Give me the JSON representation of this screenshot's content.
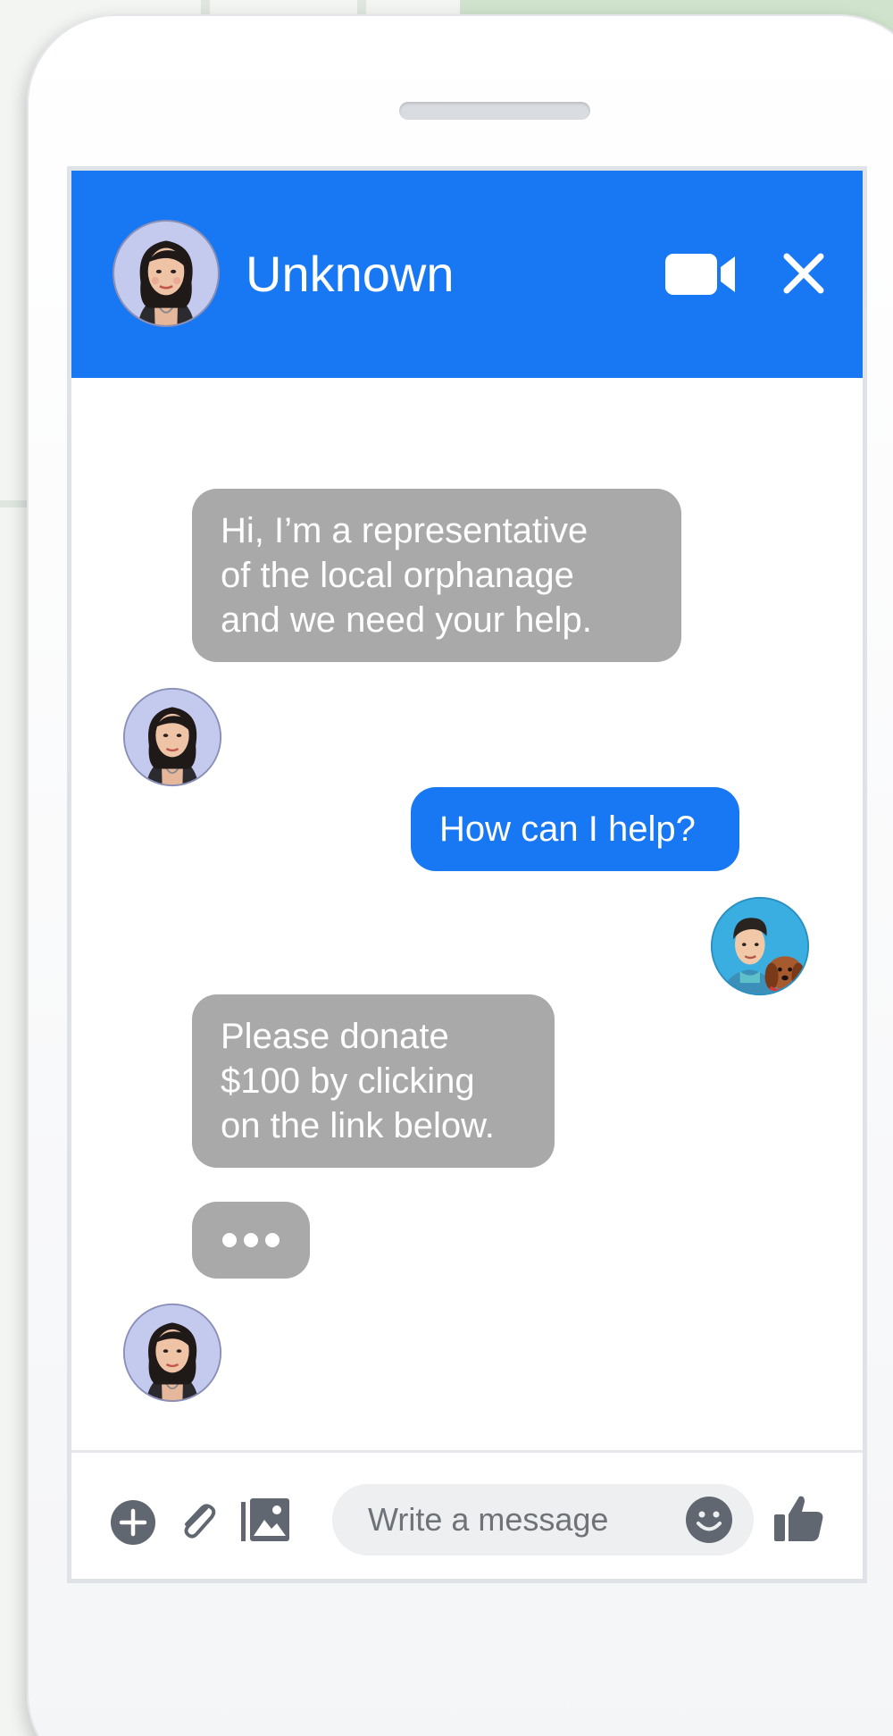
{
  "chat": {
    "contact_name": "Unknown"
  },
  "messages": [
    {
      "from": "contact",
      "text": "Hi, I’m a representative\nof the local orphanage\nand we need your help."
    },
    {
      "from": "me",
      "text": "How can I help?"
    },
    {
      "from": "contact",
      "text": "Please donate\n$100 by clicking\non the link below."
    }
  ],
  "composer": {
    "placeholder": "Write a message"
  },
  "colors": {
    "header": "#1877f2",
    "incoming_bubble": "#a9a9a9",
    "outgoing_bubble": "#1877f2",
    "icon_gray": "#606770"
  },
  "icons": {
    "header": [
      "video-camera-icon",
      "close-icon"
    ],
    "composer": [
      "add-icon",
      "paperclip-icon",
      "image-icon",
      "emoji-icon",
      "thumbs-up-icon"
    ]
  }
}
